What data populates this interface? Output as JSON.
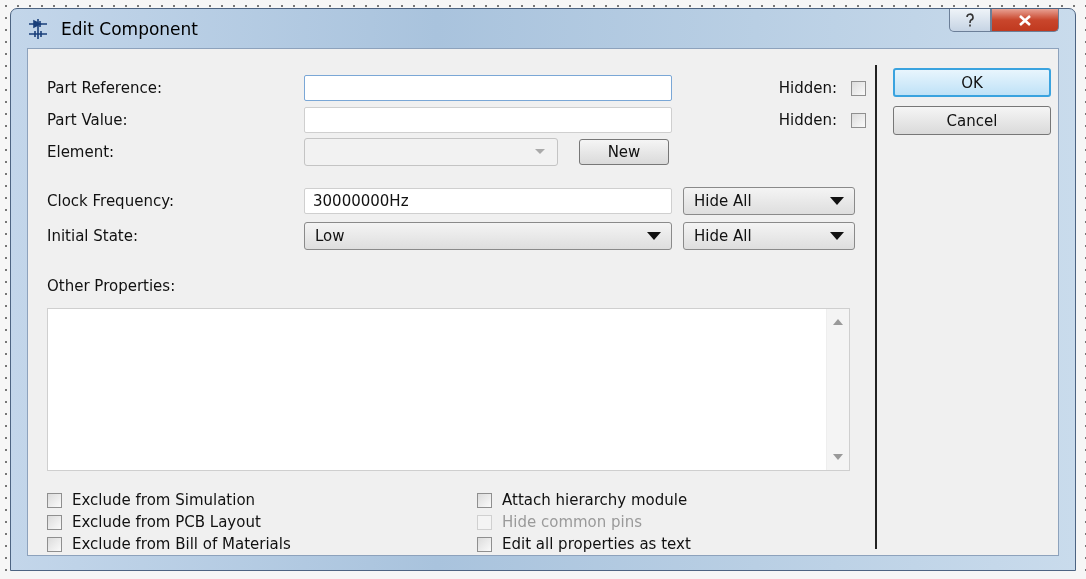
{
  "window": {
    "title": "Edit Component"
  },
  "fields": [
    {
      "kind": "text",
      "label": "Part Reference:",
      "focused": true,
      "hidden": {
        "label": "Hidden:",
        "checked": false
      }
    },
    {
      "kind": "text",
      "label": "Part Value:",
      "focused": false,
      "hidden": {
        "label": "Hidden:",
        "checked": false
      }
    },
    {
      "kind": "combo",
      "label": "Element:",
      "disabled": true,
      "button": "New"
    }
  ],
  "properties": [
    {
      "kind": "text",
      "label": "Clock Frequency:",
      "value": "30000000Hz",
      "visibility": "Hide All"
    },
    {
      "kind": "select",
      "label": "Initial State:",
      "value": "Low",
      "visibility": "Hide All"
    }
  ],
  "other_properties": {
    "label": "Other Properties:"
  },
  "options": [
    {
      "label": "Exclude from Simulation",
      "checked": false,
      "disabled": false
    },
    {
      "label": "Exclude from PCB Layout",
      "checked": false,
      "disabled": false
    },
    {
      "label": "Exclude from Bill of Materials",
      "checked": false,
      "disabled": false
    },
    {
      "label": "Attach hierarchy module",
      "checked": false,
      "disabled": false
    },
    {
      "label": "Hide common pins",
      "checked": false,
      "disabled": true
    },
    {
      "label": "Edit all properties as text",
      "checked": false,
      "disabled": false
    }
  ],
  "buttons": [
    {
      "label": "OK",
      "default": true
    },
    {
      "label": "Cancel",
      "default": false
    }
  ]
}
